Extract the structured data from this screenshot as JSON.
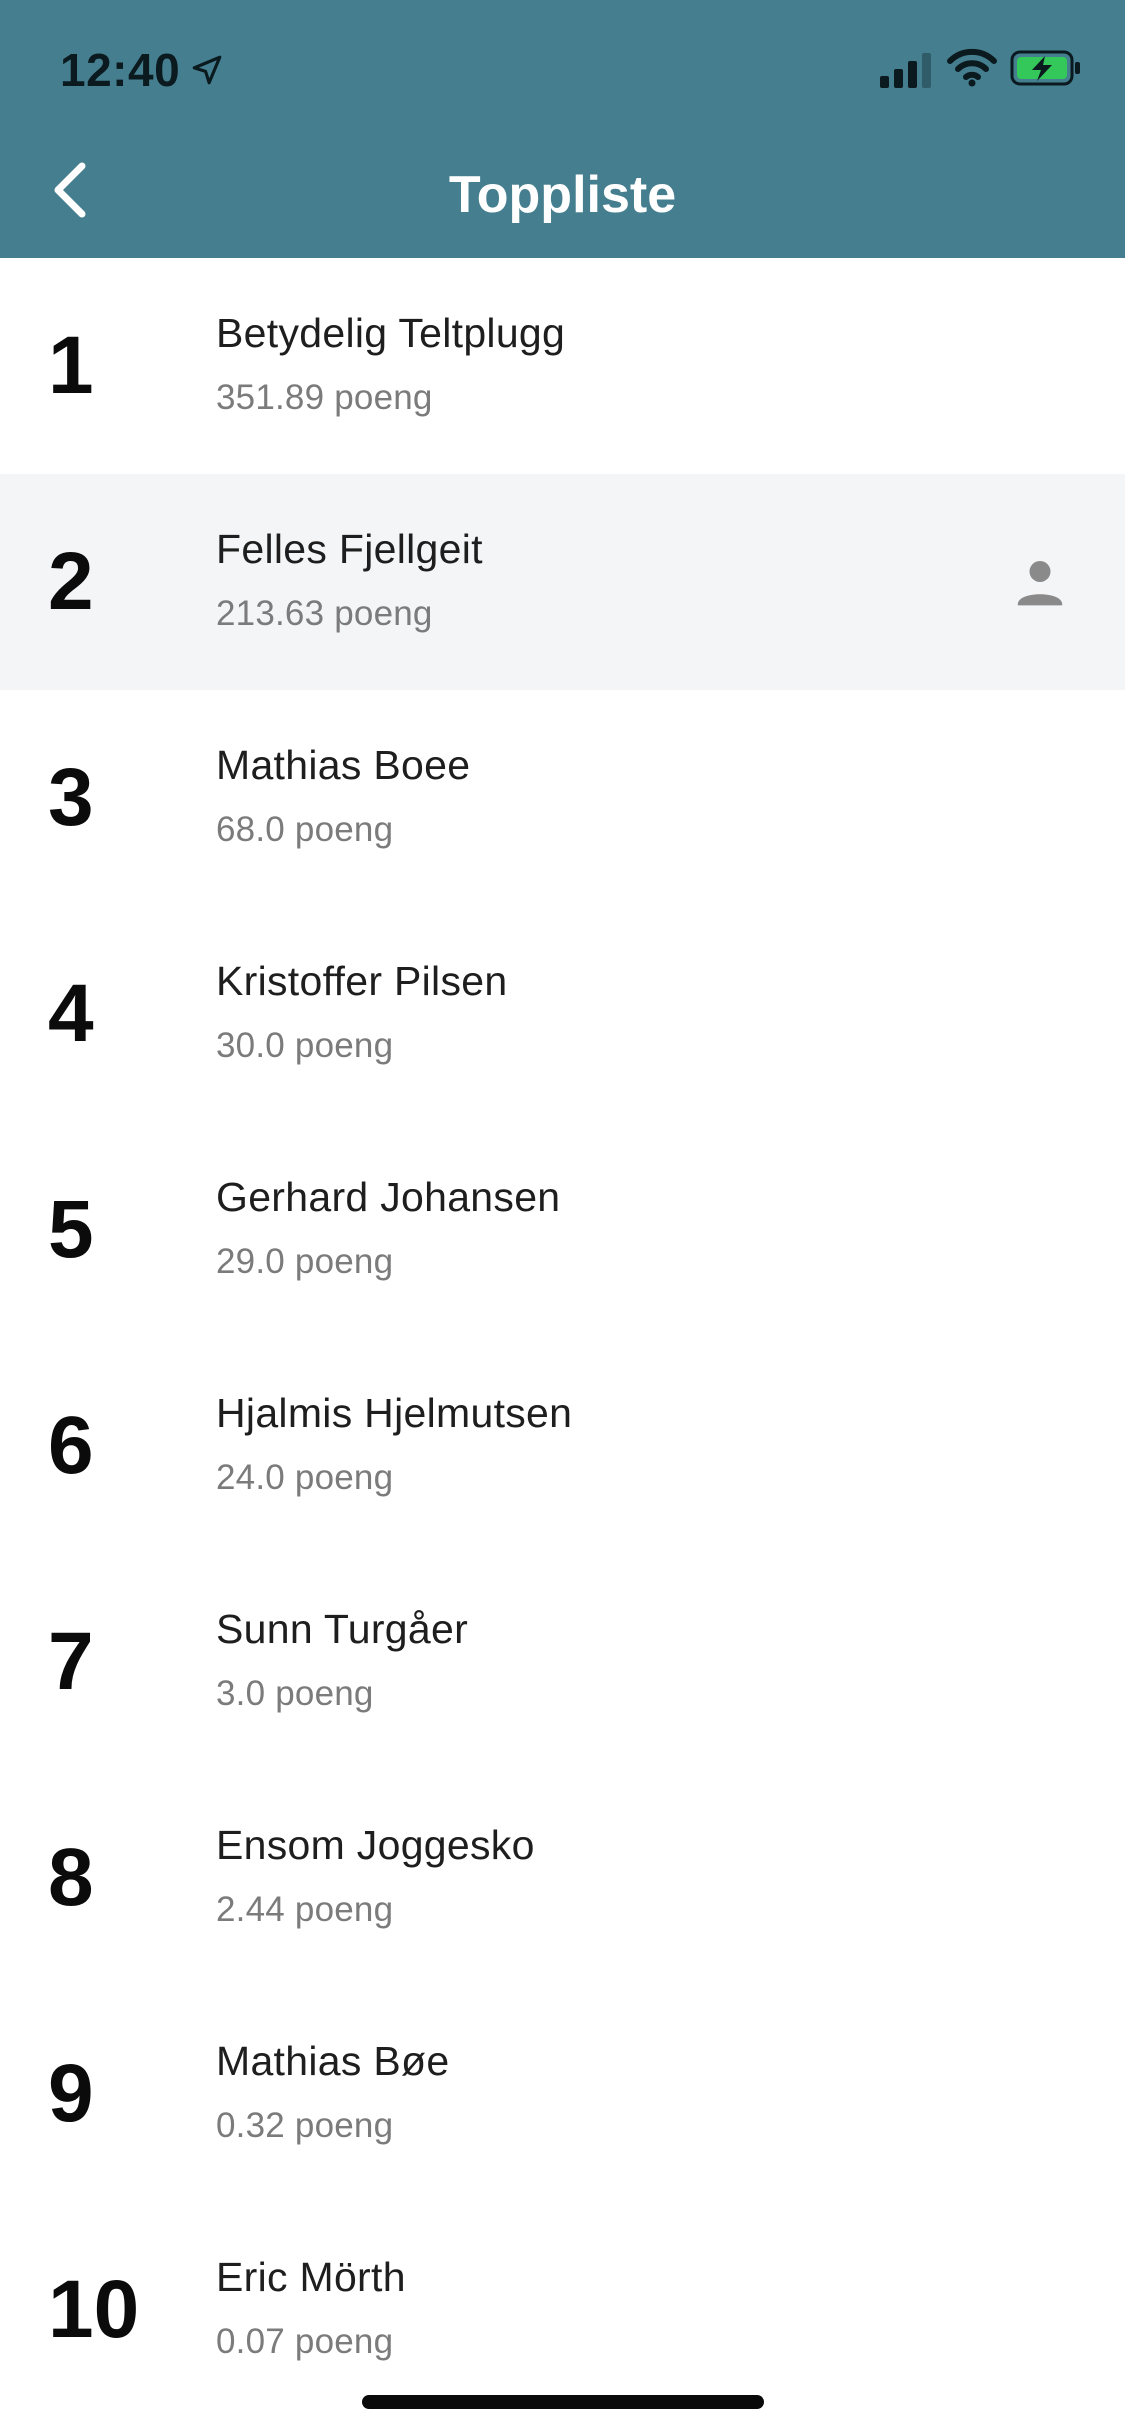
{
  "status_bar": {
    "time": "12:40",
    "icons": [
      "location-arrow-icon",
      "cellular-signal-icon",
      "wifi-icon",
      "battery-charging-icon"
    ]
  },
  "nav": {
    "title": "Toppliste",
    "back_icon": "chevron-left-icon"
  },
  "colors": {
    "header_bg": "#457f8f",
    "highlight_row_bg": "#f4f5f7",
    "battery_fill": "#34c759"
  },
  "points_unit": "poeng",
  "leaderboard": [
    {
      "rank": "1",
      "name": "Betydelig Teltplugg",
      "points": "351.89"
    },
    {
      "rank": "2",
      "name": "Felles Fjellgeit",
      "points": "213.63",
      "current_user": true
    },
    {
      "rank": "3",
      "name": "Mathias Boee",
      "points": "68.0"
    },
    {
      "rank": "4",
      "name": "Kristoffer Pilsen",
      "points": "30.0"
    },
    {
      "rank": "5",
      "name": "Gerhard Johansen",
      "points": "29.0"
    },
    {
      "rank": "6",
      "name": "Hjalmis Hjelmutsen",
      "points": "24.0"
    },
    {
      "rank": "7",
      "name": "Sunn Turgåer",
      "points": "3.0"
    },
    {
      "rank": "8",
      "name": "Ensom Joggesko",
      "points": "2.44"
    },
    {
      "rank": "9",
      "name": "Mathias Bøe",
      "points": "0.32"
    },
    {
      "rank": "10",
      "name": "Eric Mörth",
      "points": "0.07"
    }
  ]
}
